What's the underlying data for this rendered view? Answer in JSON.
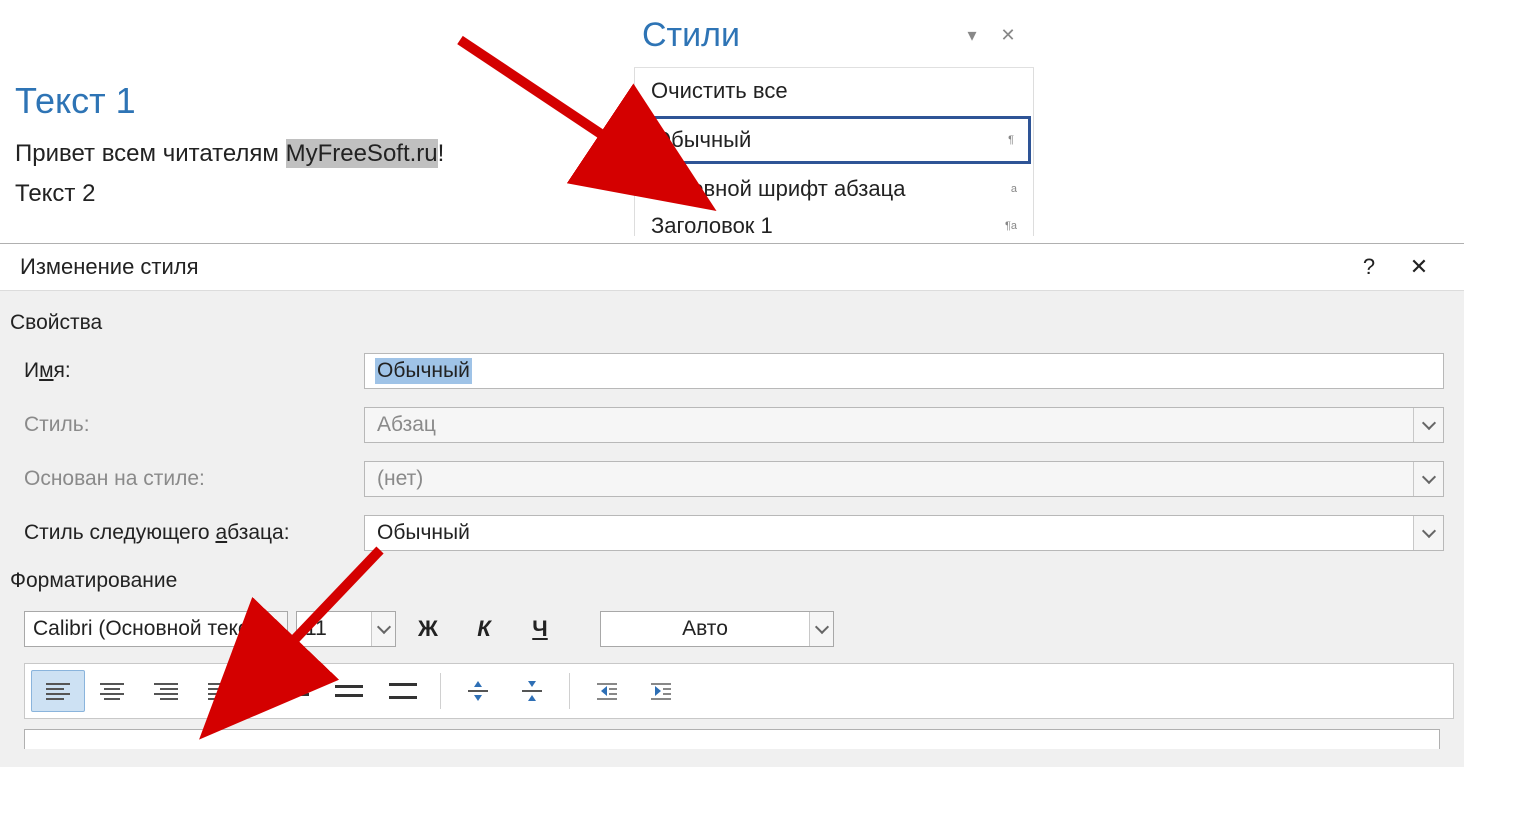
{
  "document": {
    "heading1": "Текст 1",
    "paragraph_before": "Привет всем читателям ",
    "paragraph_selected": "MyFreeSoft.ru",
    "paragraph_after": "!",
    "heading2": "Текст 2"
  },
  "styles_pane": {
    "title": "Стили",
    "items": {
      "clear": "Очистить все",
      "normal": "Обычный",
      "default_font": "Основной шрифт абзаца",
      "heading1": "Заголовок 1"
    }
  },
  "dialog": {
    "title": "Изменение стиля",
    "help": "?",
    "props_section": "Свойства",
    "label_name_pre": "И",
    "label_name_u": "м",
    "label_name_post": "я:",
    "name_value": "Обычный",
    "label_style": "Стиль:",
    "style_value": "Абзац",
    "label_based": "Основан на стиле:",
    "based_value": "(нет)",
    "label_next_pre": "Стиль следующего ",
    "label_next_u": "а",
    "label_next_post": "бзаца:",
    "next_value": "Обычный",
    "fmt_section": "Форматирование",
    "font_name": "Calibri (Основной текс",
    "font_size": "11",
    "bold": "Ж",
    "italic": "К",
    "underline": "Ч",
    "color": "Авто"
  }
}
